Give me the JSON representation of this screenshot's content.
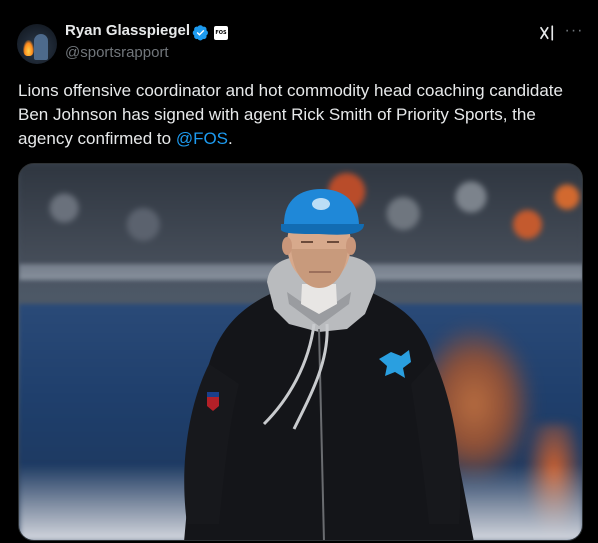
{
  "author": {
    "display_name": "Ryan Glasspiegel",
    "handle": "@sportsrapport",
    "affiliate_badge": "FOS",
    "avatar_icon": "profile-avatar",
    "verified_icon": "verified-badge-icon"
  },
  "header_actions": {
    "grok_icon": "grok-icon",
    "more_label": "···"
  },
  "tweet": {
    "text_before_mention": "Lions offensive coordinator and hot commodity head coaching candidate Ben Johnson has signed with agent Rick Smith of Priority Sports, the agency confirmed to ",
    "mention": "@FOS",
    "text_after_mention": "."
  },
  "media": {
    "type": "photo"
  },
  "colors": {
    "background": "#000000",
    "text": "#e7e9ea",
    "secondary_text": "#71767b",
    "link": "#1d9bf0",
    "verified": "#1d9bf0"
  }
}
